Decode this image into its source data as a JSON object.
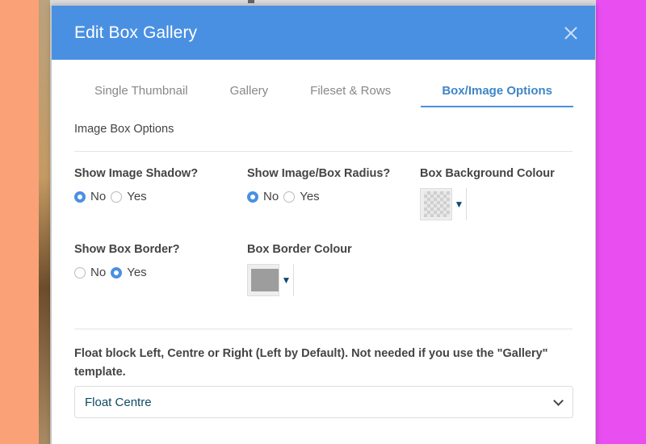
{
  "modal": {
    "title": "Edit Box Gallery"
  },
  "tabs": [
    {
      "label": "Single Thumbnail"
    },
    {
      "label": "Gallery"
    },
    {
      "label": "Fileset & Rows"
    },
    {
      "label": "Box/Image Options",
      "active": true
    }
  ],
  "section_title": "Image Box Options",
  "shadow": {
    "label": "Show Image Shadow?",
    "options": [
      "No",
      "Yes"
    ],
    "selected": "No"
  },
  "radius": {
    "label": "Show Image/Box Radius?",
    "options": [
      "No",
      "Yes"
    ],
    "selected": "No"
  },
  "bg_colour": {
    "label": "Box Background Colour",
    "value": "transparent"
  },
  "border": {
    "label": "Show Box Border?",
    "options": [
      "No",
      "Yes"
    ],
    "selected": "Yes"
  },
  "border_colour": {
    "label": "Box Border Colour",
    "value": "#9d9d9d"
  },
  "float": {
    "label": "Float block Left, Centre or Right (Left by Default). Not needed if you use the \"Gallery\" template.",
    "selected": "Float Centre"
  },
  "colors": {
    "accent": "#4a90e2",
    "active_tab": "#3f85c9"
  }
}
